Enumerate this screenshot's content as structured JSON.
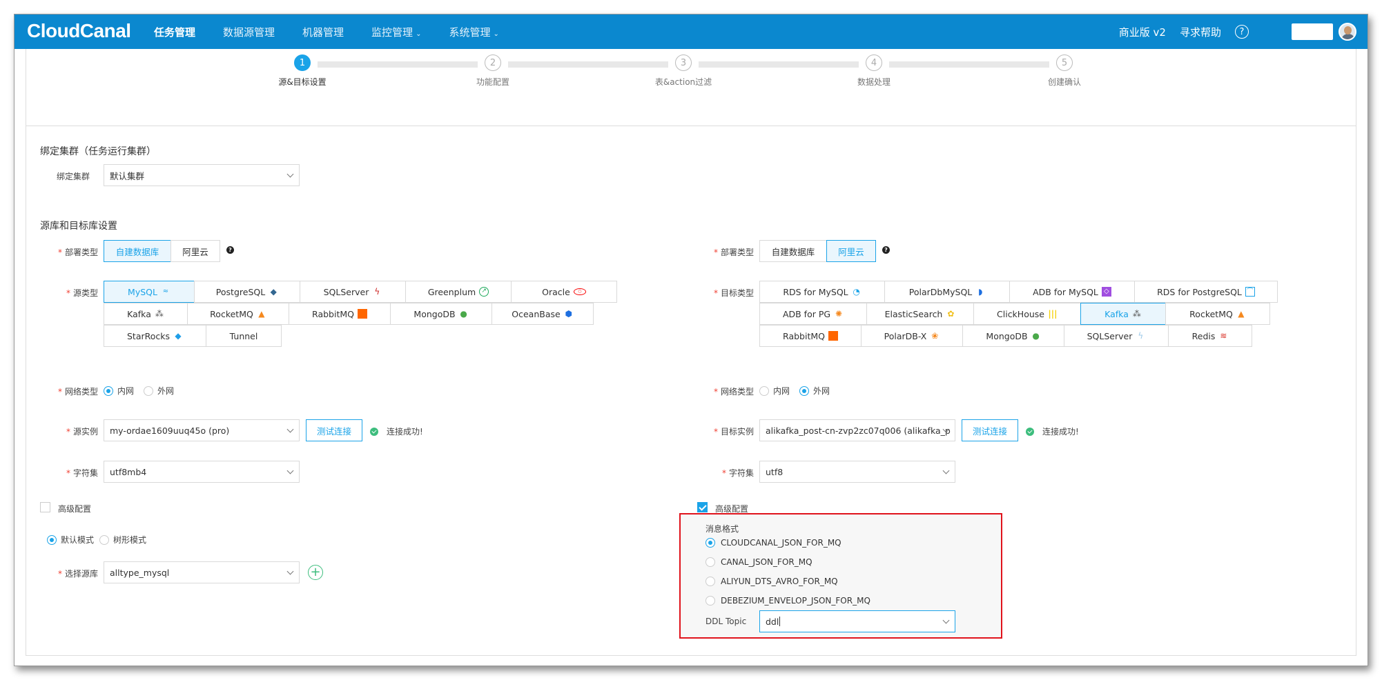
{
  "brand": "CloudCanal",
  "nav": {
    "items": [
      {
        "label": "任务管理",
        "active": true,
        "dropdown": false
      },
      {
        "label": "数据源管理",
        "active": false,
        "dropdown": false
      },
      {
        "label": "机器管理",
        "active": false,
        "dropdown": false
      },
      {
        "label": "监控管理",
        "active": false,
        "dropdown": true
      },
      {
        "label": "系统管理",
        "active": false,
        "dropdown": true
      }
    ],
    "chevron": "⌄",
    "edition": "商业版 v2",
    "help": "寻求帮助",
    "help_icon": "?"
  },
  "steps": [
    {
      "num": "1",
      "label": "源&目标设置",
      "active": true
    },
    {
      "num": "2",
      "label": "功能配置",
      "active": false
    },
    {
      "num": "3",
      "label": "表&action过滤",
      "active": false
    },
    {
      "num": "4",
      "label": "数据处理",
      "active": false
    },
    {
      "num": "5",
      "label": "创建确认",
      "active": false
    }
  ],
  "cluster": {
    "section_title": "绑定集群（任务运行集群）",
    "label": "绑定集群",
    "value": "默认集群"
  },
  "db_section_title": "源库和目标库设置",
  "source": {
    "deploy_label": "部署类型",
    "deploy_options": [
      "自建数据库",
      "阿里云"
    ],
    "deploy_selected": 0,
    "type_label": "源类型",
    "types": [
      [
        "MySQL",
        "PostgreSQL",
        "SQLServer",
        "Greenplum",
        "Oracle"
      ],
      [
        "Kafka",
        "RocketMQ",
        "RabbitMQ",
        "MongoDB",
        "OceanBase"
      ],
      [
        "StarRocks",
        "Tunnel"
      ]
    ],
    "type_selected": "MySQL",
    "network_label": "网络类型",
    "network_options": [
      "内网",
      "外网"
    ],
    "network_selected": 0,
    "instance_label": "源实例",
    "instance_value": "my-ordae1609uuq45o (pro)",
    "test_button": "测试连接",
    "conn_status": "连接成功!",
    "charset_label": "字符集",
    "charset_value": "utf8mb4",
    "advanced_label": "高级配置",
    "advanced_checked": false,
    "mode_options": [
      "默认模式",
      "树形模式"
    ],
    "mode_selected": 0,
    "select_db_label": "选择源库",
    "select_db_value": "alltype_mysql",
    "add_icon": "+"
  },
  "target": {
    "deploy_label": "部署类型",
    "deploy_options": [
      "自建数据库",
      "阿里云"
    ],
    "deploy_selected": 1,
    "type_label": "目标类型",
    "types": [
      [
        "RDS for MySQL",
        "PolarDbMySQL",
        "ADB for MySQL",
        "RDS for PostgreSQL"
      ],
      [
        "ADB for PG",
        "ElasticSearch",
        "ClickHouse",
        "Kafka",
        "RocketMQ"
      ],
      [
        "RabbitMQ",
        "PolarDB-X",
        "MongoDB",
        "SQLServer",
        "Redis"
      ]
    ],
    "type_selected": "Kafka",
    "network_label": "网络类型",
    "network_options": [
      "内网",
      "外网"
    ],
    "network_selected": 1,
    "instance_label": "目标实例",
    "instance_value": "alikafka_post-cn-zvp2zc07q006 (alikafka_p",
    "test_button": "测试连接",
    "conn_status": "连接成功!",
    "charset_label": "字符集",
    "charset_value": "utf8",
    "advanced_label": "高级配置",
    "advanced_checked": true,
    "msg_format_label": "消息格式",
    "msg_formats": [
      "CLOUDCANAL_JSON_FOR_MQ",
      "CANAL_JSON_FOR_MQ",
      "ALIYUN_DTS_AVRO_FOR_MQ",
      "DEBEZIUM_ENVELOP_JSON_FOR_MQ"
    ],
    "msg_format_selected": 0,
    "ddl_topic_label": "DDL Topic",
    "ddl_topic_value": "ddl"
  },
  "colors": {
    "brand": "#0b88cf",
    "accent": "#1aa3e8",
    "success": "#3dbd7d",
    "required": "#f04134",
    "highlight_box": "#e0121b"
  }
}
